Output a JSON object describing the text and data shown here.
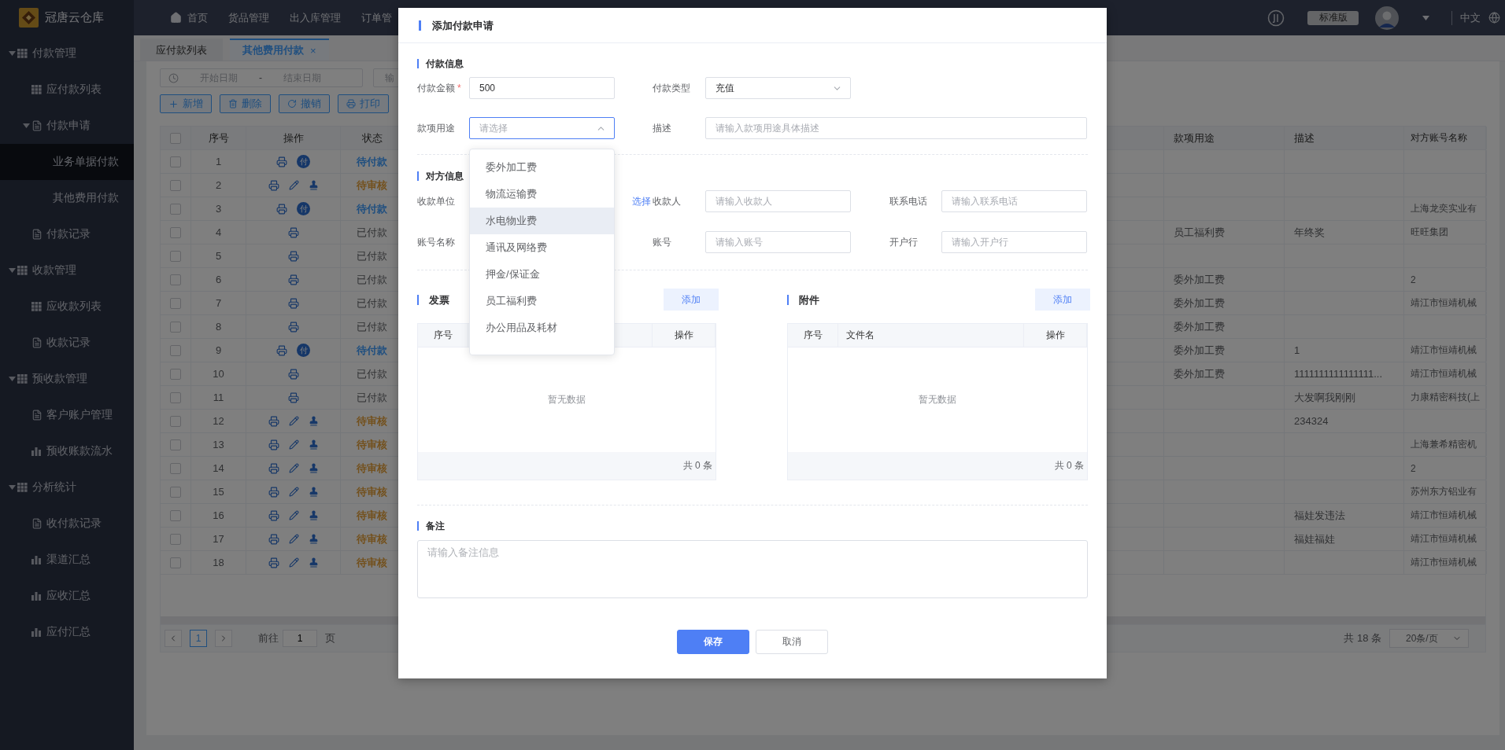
{
  "app": {
    "name": "冠唐云仓库"
  },
  "nav": [
    {
      "label": "首页",
      "kind": "home"
    },
    {
      "label": "货品管理",
      "kind": "text"
    },
    {
      "label": "出入库管理",
      "kind": "text"
    },
    {
      "label": "订单管",
      "kind": "text"
    }
  ],
  "header_right": {
    "edition": "标准版",
    "language": "中文"
  },
  "sidebar": [
    {
      "label": "付款管理",
      "kind": "group",
      "expanded": true,
      "selected": false,
      "children": [
        {
          "label": "应付款列表",
          "kind": "table",
          "selected": false
        },
        {
          "label": "付款申请",
          "kind": "doc",
          "expanded": true,
          "selected": false,
          "children": [
            {
              "label": "业务单据付款",
              "kind": "leaf",
              "selected": true
            },
            {
              "label": "其他费用付款",
              "kind": "leaf",
              "selected": false
            }
          ]
        },
        {
          "label": "付款记录",
          "kind": "doc",
          "selected": false
        }
      ]
    },
    {
      "label": "收款管理",
      "kind": "group",
      "expanded": true,
      "selected": false,
      "children": [
        {
          "label": "应收款列表",
          "kind": "table",
          "selected": false
        },
        {
          "label": "收款记录",
          "kind": "doc",
          "selected": false
        }
      ]
    },
    {
      "label": "预收款管理",
      "kind": "group",
      "expanded": true,
      "selected": false,
      "children": [
        {
          "label": "客户账户管理",
          "kind": "doc",
          "selected": false
        },
        {
          "label": "预收账款流水",
          "kind": "chart",
          "selected": false
        }
      ]
    },
    {
      "label": "分析统计",
      "kind": "group",
      "expanded": true,
      "selected": false,
      "children": [
        {
          "label": "收付款记录",
          "kind": "doc",
          "selected": false
        },
        {
          "label": "渠道汇总",
          "kind": "chart",
          "selected": false
        },
        {
          "label": "应收汇总",
          "kind": "chart",
          "selected": false
        },
        {
          "label": "应付汇总",
          "kind": "chart",
          "selected": false
        }
      ]
    }
  ],
  "tabs": [
    {
      "label": "应付款列表",
      "selected": false
    },
    {
      "label": "其他费用付款",
      "selected": true,
      "close": "×"
    }
  ],
  "filters": {
    "start_placeholder": "开始日期",
    "separator": "-",
    "end_placeholder": "结束日期",
    "search_placeholder": "输"
  },
  "toolbar": [
    {
      "label": "新增",
      "kind": "add"
    },
    {
      "label": "删除",
      "kind": "delete"
    },
    {
      "label": "撤销",
      "kind": "undo"
    },
    {
      "label": "打印",
      "kind": "print"
    }
  ],
  "table": {
    "all_checked": false,
    "columns": [
      "序号",
      "操作",
      "状态",
      "款项用途",
      "描述",
      "对方账号名称"
    ],
    "rows": [
      {
        "no": "1",
        "checked": false,
        "ops": [
          {
            "kind": "print"
          },
          {
            "kind": "pay",
            "label": "付"
          }
        ],
        "status": {
          "text": "待付款",
          "kind": "pending_payment"
        }
      },
      {
        "no": "2",
        "checked": false,
        "ops": [
          {
            "kind": "print"
          },
          {
            "kind": "edit"
          },
          {
            "kind": "approve"
          }
        ],
        "status": {
          "text": "待审核",
          "kind": "pending_review"
        }
      },
      {
        "no": "3",
        "checked": false,
        "ops": [
          {
            "kind": "print"
          },
          {
            "kind": "pay",
            "label": "付"
          }
        ],
        "status": {
          "text": "待付款",
          "kind": "pending_payment"
        },
        "account": "上海龙奕实业有"
      },
      {
        "no": "4",
        "checked": false,
        "ops": [
          {
            "kind": "print"
          }
        ],
        "status": {
          "text": "已付款",
          "kind": "paid"
        },
        "purpose": "员工福利费",
        "desc": "年终奖",
        "account": "旺旺集团"
      },
      {
        "no": "5",
        "checked": false,
        "ops": [
          {
            "kind": "print"
          }
        ],
        "status": {
          "text": "已付款",
          "kind": "paid"
        }
      },
      {
        "no": "6",
        "checked": false,
        "ops": [
          {
            "kind": "print"
          }
        ],
        "status": {
          "text": "已付款",
          "kind": "paid"
        },
        "purpose": "委外加工费",
        "account": "2"
      },
      {
        "no": "7",
        "checked": false,
        "ops": [
          {
            "kind": "print"
          }
        ],
        "status": {
          "text": "已付款",
          "kind": "paid"
        },
        "purpose": "委外加工费",
        "account": "靖江市恒靖机械"
      },
      {
        "no": "8",
        "checked": false,
        "ops": [
          {
            "kind": "print"
          }
        ],
        "status": {
          "text": "已付款",
          "kind": "paid"
        },
        "purpose": "委外加工费"
      },
      {
        "no": "9",
        "checked": false,
        "ops": [
          {
            "kind": "print"
          },
          {
            "kind": "pay",
            "label": "付"
          }
        ],
        "status": {
          "text": "待付款",
          "kind": "pending_payment"
        },
        "purpose": "委外加工费",
        "desc": "1",
        "account": "靖江市恒靖机械"
      },
      {
        "no": "10",
        "checked": false,
        "ops": [
          {
            "kind": "print"
          }
        ],
        "status": {
          "text": "已付款",
          "kind": "paid"
        },
        "purpose": "委外加工费",
        "desc": "1111111111111111...",
        "account": "靖江市恒靖机械"
      },
      {
        "no": "11",
        "checked": false,
        "ops": [
          {
            "kind": "print"
          }
        ],
        "status": {
          "text": "已付款",
          "kind": "paid"
        },
        "desc": "大发啊我刚刚",
        "account": "力康精密科技(上"
      },
      {
        "no": "12",
        "checked": false,
        "ops": [
          {
            "kind": "print"
          },
          {
            "kind": "edit"
          },
          {
            "kind": "approve"
          }
        ],
        "status": {
          "text": "待审核",
          "kind": "pending_review"
        },
        "desc": "234324"
      },
      {
        "no": "13",
        "checked": false,
        "ops": [
          {
            "kind": "print"
          },
          {
            "kind": "edit"
          },
          {
            "kind": "approve"
          }
        ],
        "status": {
          "text": "待审核",
          "kind": "pending_review"
        },
        "account": "上海兼希精密机"
      },
      {
        "no": "14",
        "checked": false,
        "ops": [
          {
            "kind": "print"
          },
          {
            "kind": "edit"
          },
          {
            "kind": "approve"
          }
        ],
        "status": {
          "text": "待审核",
          "kind": "pending_review"
        },
        "account": "2"
      },
      {
        "no": "15",
        "checked": false,
        "ops": [
          {
            "kind": "print"
          },
          {
            "kind": "edit"
          },
          {
            "kind": "approve"
          }
        ],
        "status": {
          "text": "待审核",
          "kind": "pending_review"
        },
        "account": "苏州东方铝业有"
      },
      {
        "no": "16",
        "checked": false,
        "ops": [
          {
            "kind": "print"
          },
          {
            "kind": "edit"
          },
          {
            "kind": "approve"
          }
        ],
        "status": {
          "text": "待审核",
          "kind": "pending_review"
        },
        "desc": "福娃发违法",
        "account": "靖江市恒靖机械"
      },
      {
        "no": "17",
        "checked": false,
        "ops": [
          {
            "kind": "print"
          },
          {
            "kind": "edit"
          },
          {
            "kind": "approve"
          }
        ],
        "status": {
          "text": "待审核",
          "kind": "pending_review"
        },
        "desc": "福娃福娃",
        "account": "靖江市恒靖机械"
      },
      {
        "no": "18",
        "checked": false,
        "ops": [
          {
            "kind": "print"
          },
          {
            "kind": "edit"
          },
          {
            "kind": "approve"
          }
        ],
        "status": {
          "text": "待审核",
          "kind": "pending_review"
        },
        "account": "靖江市恒靖机械"
      }
    ]
  },
  "pagination": {
    "pages": [
      {
        "label": "1",
        "selected": true
      }
    ],
    "goto_label": "前往",
    "goto_value": "1",
    "page_suffix": "页",
    "total": "共 18 条",
    "page_size": "20条/页"
  },
  "modal": {
    "title": "添加付款申请",
    "payment": {
      "title": "付款信息",
      "amount": {
        "label": "付款金额",
        "required_mark": "*",
        "value": "500"
      },
      "type": {
        "label": "付款类型",
        "value": "充值"
      },
      "purpose": {
        "label": "款项用途",
        "placeholder": "请选择",
        "open": true,
        "options": [
          {
            "label": "委外加工费",
            "hovered": false
          },
          {
            "label": "物流运输费",
            "hovered": false
          },
          {
            "label": "水电物业费",
            "hovered": true
          },
          {
            "label": "通讯及网络费",
            "hovered": false
          },
          {
            "label": "押金/保证金",
            "hovered": false
          },
          {
            "label": "员工福利费",
            "hovered": false
          },
          {
            "label": "办公用品及耗材",
            "hovered": false
          }
        ]
      },
      "description": {
        "label": "描述",
        "placeholder": "请输入款项用途具体描述"
      }
    },
    "party": {
      "title": "对方信息",
      "payee_unit": {
        "label": "收款单位",
        "link": "选择"
      },
      "payee": {
        "label": "收款人",
        "placeholder": "请输入收款人"
      },
      "phone": {
        "label": "联系电话",
        "placeholder": "请输入联系电话"
      },
      "account_name": {
        "label": "账号名称"
      },
      "account": {
        "label": "账号",
        "placeholder": "请输入账号"
      },
      "bank": {
        "label": "开户行",
        "placeholder": "请输入开户行"
      }
    },
    "panels": [
      {
        "title": "发票",
        "add": "添加",
        "columns": [
          "序号",
          "操作"
        ],
        "empty": "暂无数据",
        "total": "共 0 条"
      },
      {
        "title": "附件",
        "add": "添加",
        "columns": [
          "序号",
          "文件名",
          "操作"
        ],
        "empty": "暂无数据",
        "total": "共 0 条"
      }
    ],
    "remark": {
      "title": "备注",
      "placeholder": "请输入备注信息"
    },
    "buttons": [
      {
        "label": "保存",
        "kind": "primary"
      },
      {
        "label": "取消",
        "kind": "default"
      }
    ]
  }
}
